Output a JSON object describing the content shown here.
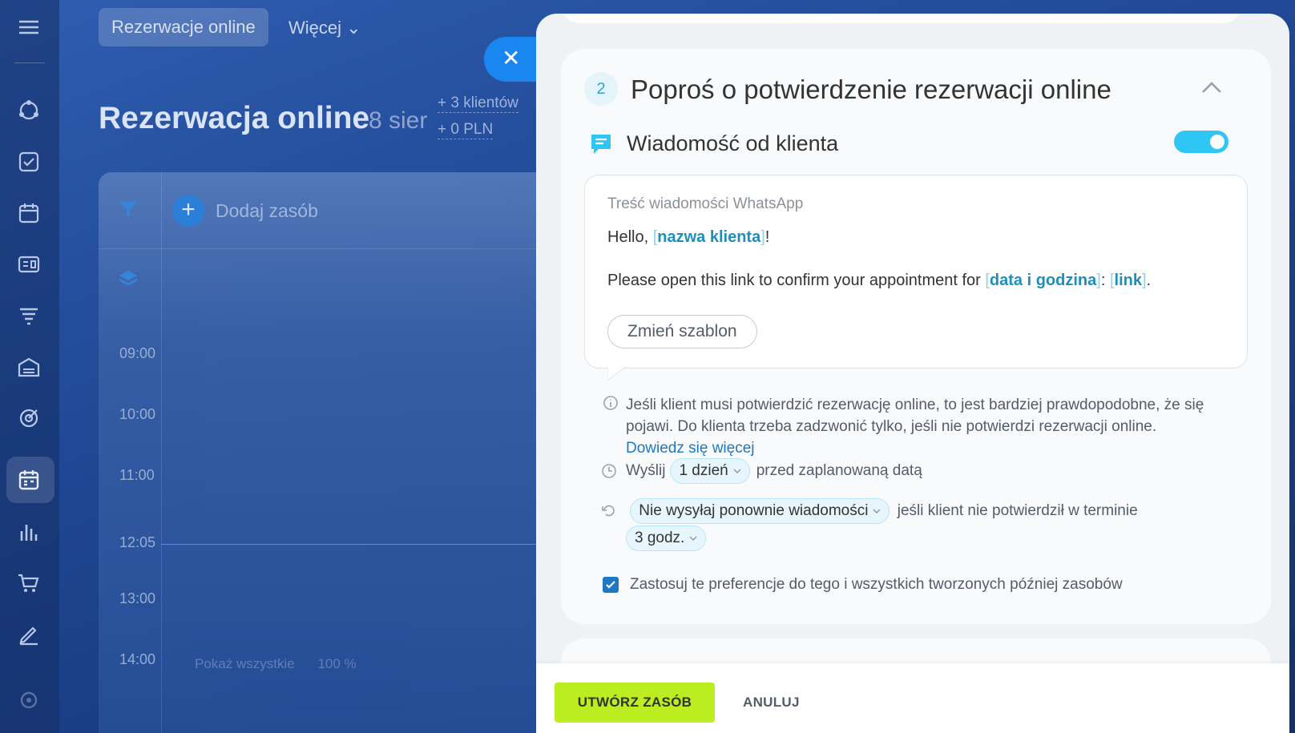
{
  "background": {
    "top_tab": "Rezerwacje online",
    "more_menu": "Więcej",
    "page_title": "Rezerwacja online",
    "page_date": "8 sier",
    "stats": {
      "clients": "+ 3 klientów",
      "revenue": "+ 0 PLN"
    },
    "add_resource": "Dodaj zasób",
    "times": [
      "09:00",
      "10:00",
      "11:00",
      "12:05",
      "13:00",
      "14:00"
    ],
    "footer_link": "Pokaż wszystkie",
    "zoom": "100 %"
  },
  "panel": {
    "step_number": "2",
    "step_title": "Poproś o potwierdzenie rezerwacji online",
    "message_section_title": "Wiadomość od klienta",
    "toggle_on": true,
    "message": {
      "label": "Treść wiadomości WhatsApp",
      "line1_prefix": "Hello, ",
      "line1_var": "nazwa klienta",
      "line1_suffix": "!",
      "line2_prefix": "Please open this link to confirm your appointment for ",
      "line2_var1": "data i godzina",
      "line2_mid": ": ",
      "line2_var2": "link",
      "line2_suffix": ".",
      "change_template": "Zmień szablon"
    },
    "info_text": "Jeśli klient musi potwierdzić rezerwację online, to jest bardziej prawdopodobne, że się pojawi. Do klienta trzeba zadzwonić tylko, jeśli nie potwierdzi rezerwacji online.",
    "info_link": "Dowiedz się więcej",
    "send": {
      "prefix": "Wyślij",
      "value": "1 dzień",
      "suffix": "przed zaplanowaną datą"
    },
    "resend": {
      "value": "Nie wysyłaj ponownie wiadomości",
      "middle": "jeśli klient nie potwierdził w terminie",
      "period": "3 godz."
    },
    "apply_checkbox": {
      "label": "Zastosuj te preferencje do tego i wszystkich tworzonych później zasobów",
      "checked": true
    }
  },
  "footer": {
    "create": "UTWÓRZ ZASÓB",
    "cancel": "ANULUJ"
  },
  "colors": {
    "accent": "#2fc6f6",
    "create_button": "#bbed21",
    "link": "#1e78c2",
    "variable": "#1e8fbd"
  }
}
